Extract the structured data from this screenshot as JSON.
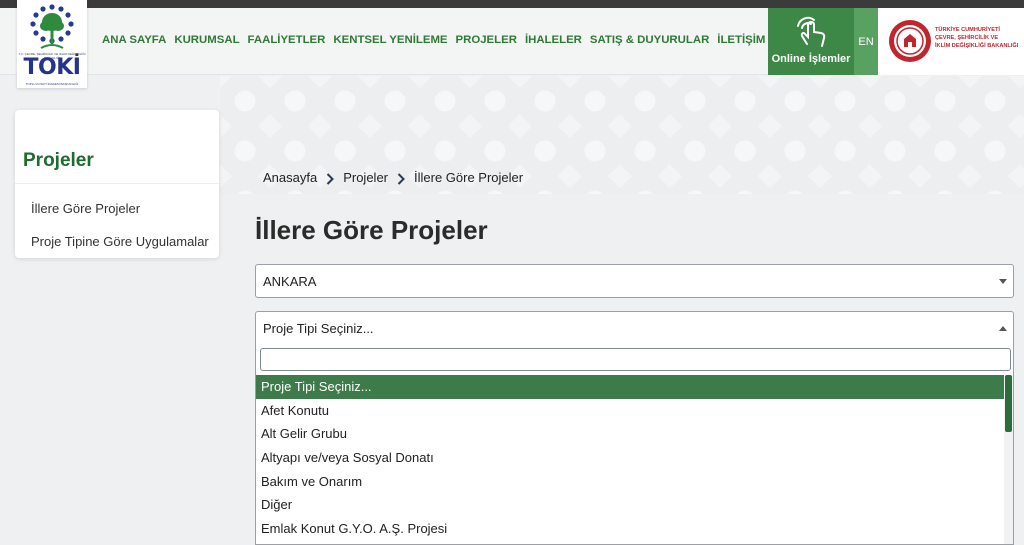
{
  "header": {
    "logo": {
      "word": "TOKİ",
      "caption_top": "T.C. ÇEVRE, ŞEHİRCİLİK VE İKLİM DEĞİŞİKLİĞİ BAKANLIĞI",
      "caption_bottom": "TOPLU KONUT İDARESİ BAŞKANLIĞI"
    },
    "nav": [
      "ANA SAYFA",
      "KURUMSAL",
      "FAALİYETLER",
      "KENTSEL YENİLEME",
      "PROJELER",
      "İHALELER",
      "SATIŞ & DUYURULAR",
      "İLETİŞİM"
    ],
    "online_label": "Online İşlemler",
    "lang": "EN",
    "ministry_lines": [
      "TÜRKİYE CUMHURİYETİ",
      "ÇEVRE, ŞEHİRCİLİK VE",
      "İKLİM DEĞİŞİKLİĞİ BAKANLIĞI"
    ]
  },
  "sidebar": {
    "title": "Projeler",
    "items": [
      "İllere Göre Projeler",
      "Proje Tipine Göre Uygulamalar"
    ]
  },
  "breadcrumb": [
    "Anasayfa",
    "Projeler",
    "İllere Göre Projeler"
  ],
  "page_title": "İllere Göre Projeler",
  "city_select": {
    "value": "ANKARA"
  },
  "type_select": {
    "value": "Proje Tipi Seçiniz...",
    "search_value": "",
    "options": [
      "Proje Tipi Seçiniz...",
      "Afet Konutu",
      "Alt Gelir Grubu",
      "Altyapı ve/veya Sosyal Donatı",
      "Bakım ve Onarım",
      "Diğer",
      "Emlak Konut G.Y.O. A.Ş. Projesi"
    ],
    "active_index": 0
  },
  "colors": {
    "nav_green": "#2f7a35",
    "online_green": "#3d8847",
    "lang_green": "#58a160",
    "active_option": "#3d7b4b",
    "ministry_red": "#c0262d",
    "logo_blue": "#2a3b8f",
    "logo_tree": "#2e8b3e"
  },
  "icons": {
    "logo": "toki-tree-logo",
    "online": "hand-tap-icon",
    "ministry": "ministry-emblem-icon",
    "breadcrumb_separator": "chevron-right-icon",
    "select_closed": "caret-down-icon",
    "select_open": "caret-up-icon"
  }
}
